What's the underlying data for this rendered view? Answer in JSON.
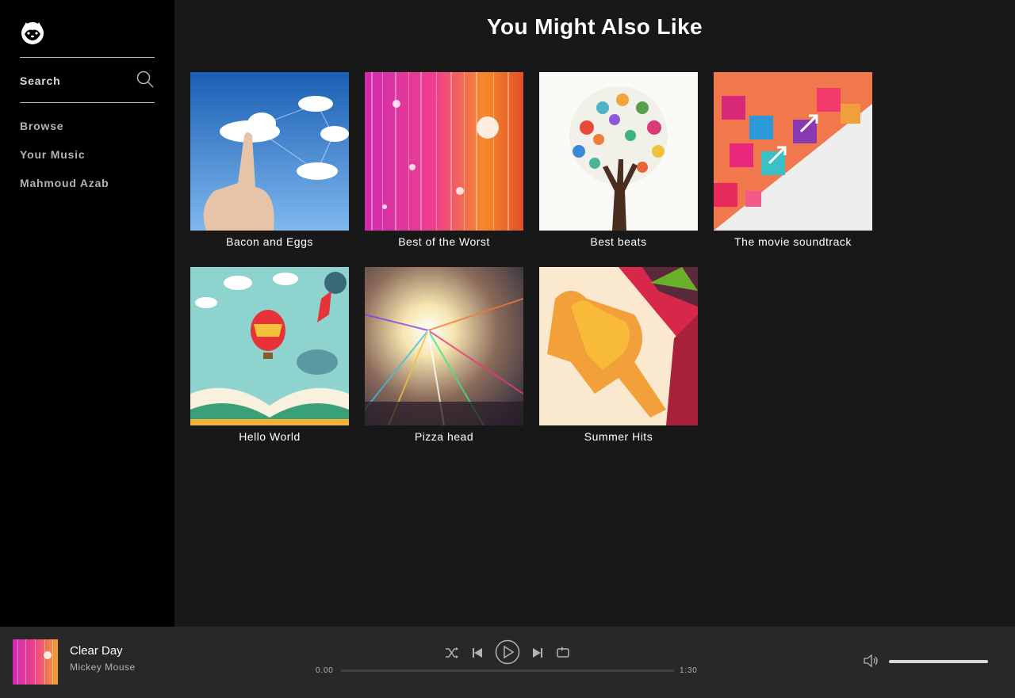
{
  "sidebar": {
    "logo_icon": "hamster-logo-icon",
    "search_label": "Search",
    "nav": [
      {
        "label": "Browse"
      },
      {
        "label": "Your Music"
      },
      {
        "label": "Mahmoud Azab"
      }
    ]
  },
  "main": {
    "title": "You Might Also Like",
    "albums": [
      {
        "title": "Bacon and Eggs",
        "art": "cloud-touch"
      },
      {
        "title": "Best of the Worst",
        "art": "glitter-stripes"
      },
      {
        "title": "Best beats",
        "art": "handprint-tree"
      },
      {
        "title": "The movie soundtrack",
        "art": "arrows-burst"
      },
      {
        "title": "Hello World",
        "art": "open-book-balloon"
      },
      {
        "title": "Pizza head",
        "art": "light-burst"
      },
      {
        "title": "Summer Hits",
        "art": "runner-silhouette"
      }
    ]
  },
  "player": {
    "track_title": "Clear Day",
    "track_artist": "Mickey Mouse",
    "elapsed": "0.00",
    "duration": "1:30",
    "progress_fraction": 0,
    "volume_fraction": 1,
    "controls": [
      "shuffle-icon",
      "previous-icon",
      "play-icon",
      "next-icon",
      "repeat-icon"
    ]
  },
  "colors": {
    "sidebar_bg": "#000000",
    "main_bg": "#181818",
    "player_bg": "#282828",
    "text_muted": "#b3b3b3"
  }
}
